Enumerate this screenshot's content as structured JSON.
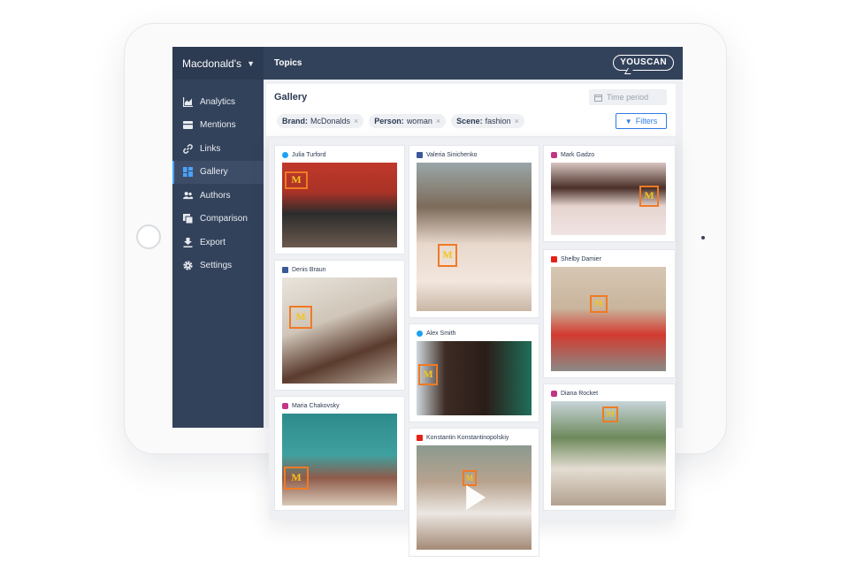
{
  "sidebar": {
    "workspace": "Macdonald's",
    "items": [
      {
        "label": "Analytics",
        "icon": "chart-icon"
      },
      {
        "label": "Mentions",
        "icon": "mentions-icon"
      },
      {
        "label": "Links",
        "icon": "link-icon"
      },
      {
        "label": "Gallery",
        "icon": "gallery-icon",
        "active": true
      },
      {
        "label": "Authors",
        "icon": "authors-icon"
      },
      {
        "label": "Comparison",
        "icon": "comparison-icon"
      },
      {
        "label": "Export",
        "icon": "export-icon"
      },
      {
        "label": "Settings",
        "icon": "gear-icon"
      }
    ]
  },
  "topbar": {
    "title": "Topics",
    "logo": "YOUSCAN"
  },
  "gallery": {
    "title": "Gallery",
    "time_period_placeholder": "Time period",
    "filters_label": "Filters",
    "chips": [
      {
        "key": "Brand:",
        "value": "McDonalds"
      },
      {
        "key": "Person:",
        "value": "woman"
      },
      {
        "key": "Scene:",
        "value": "fashion"
      }
    ]
  },
  "cards": [
    {
      "author": "Julia Turford",
      "network": "twitter"
    },
    {
      "author": "Denis Braun",
      "network": "facebook"
    },
    {
      "author": "Maria Chakovsky",
      "network": "instagram"
    },
    {
      "author": "Valeria Sinichenko",
      "network": "facebook"
    },
    {
      "author": "Alex Smith",
      "network": "twitter"
    },
    {
      "author": "Konstantin Konstantinopolskiy",
      "network": "youtube"
    },
    {
      "author": "Mark Gadzo",
      "network": "instagram"
    },
    {
      "author": "Shelby Damier",
      "network": "youtube"
    },
    {
      "author": "Diana Rocket",
      "network": "instagram"
    }
  ],
  "colors": {
    "sidebar": "#33425b",
    "accent": "#2f7be5",
    "tag": "#f07a24",
    "twitter": "#1da1f2",
    "facebook": "#3b5998",
    "instagram": "#c13584",
    "youtube": "#e62117"
  }
}
